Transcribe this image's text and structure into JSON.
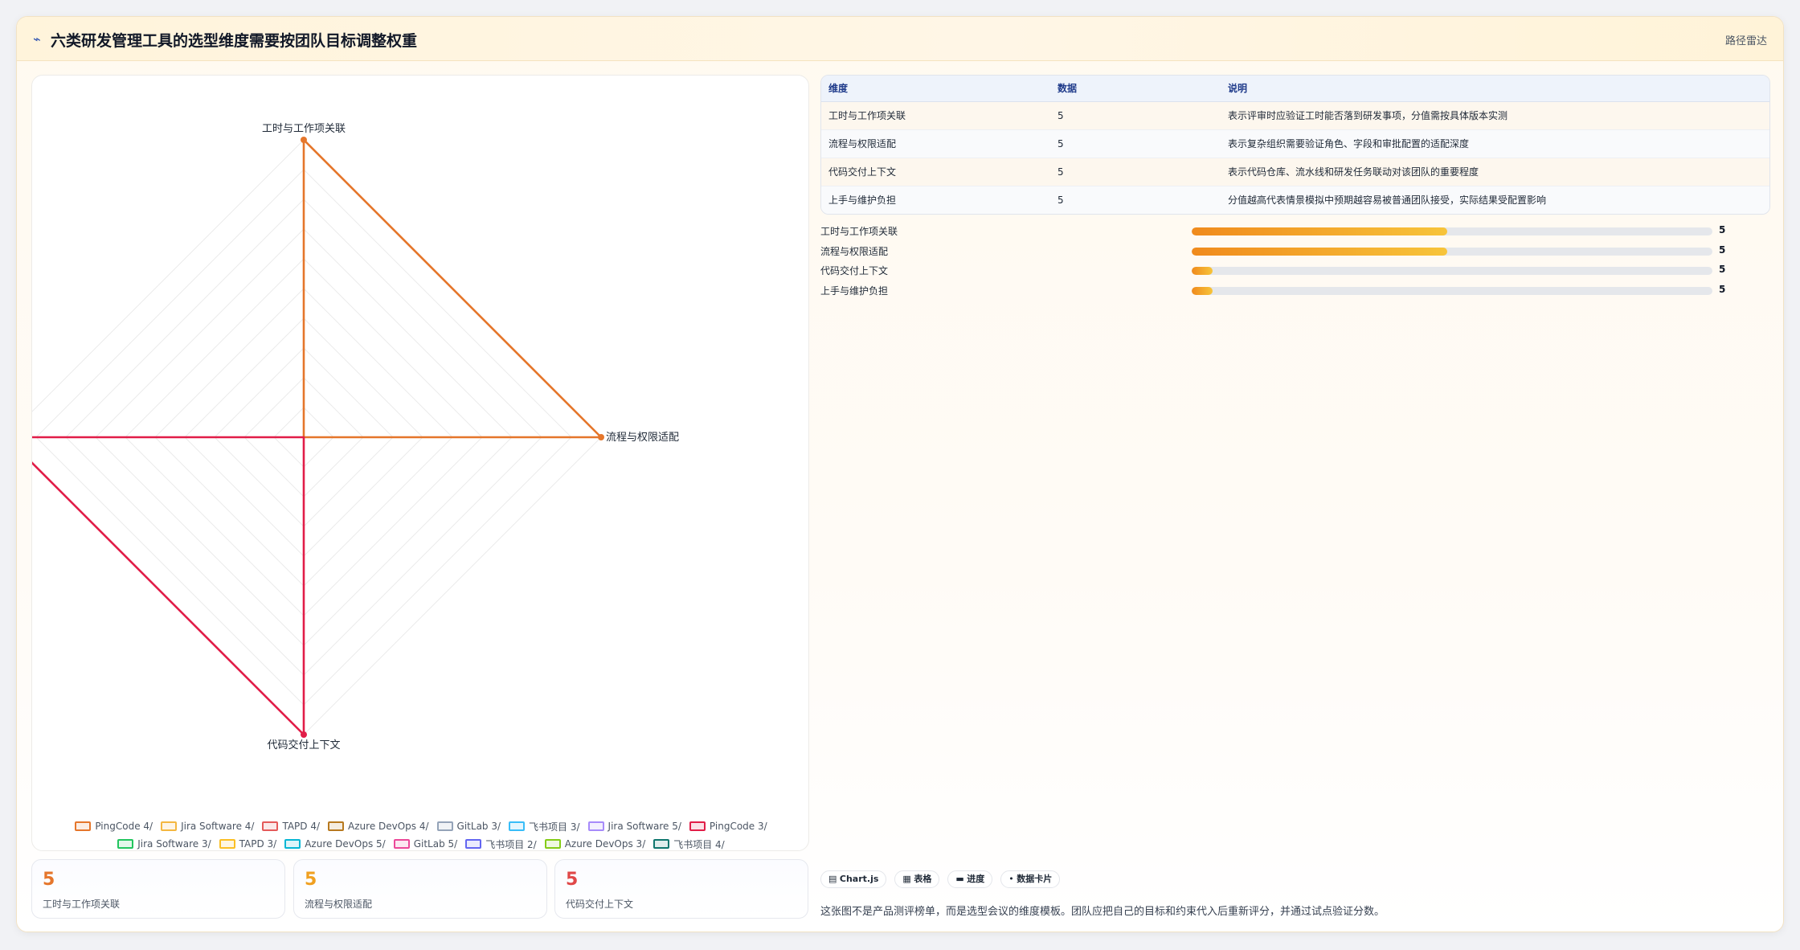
{
  "header": {
    "icon": "trend-line-icon",
    "title": "六类研发管理工具的选型维度需要按团队目标调整权重",
    "link": "路径雷达"
  },
  "chart_data": {
    "type": "radar",
    "axes": [
      "工时与工作项关联",
      "流程与权限适配",
      "代码交付上下文",
      "上手与维护负担"
    ],
    "rmax": 5,
    "grid_rings": 10,
    "series": [
      {
        "name": "PingCode 4/",
        "color": "#e5762b",
        "values": [
          5,
          5,
          0,
          0
        ]
      },
      {
        "name": "Jira Software 4/",
        "color": "#f4b740",
        "values": [
          0,
          0,
          0,
          0
        ]
      },
      {
        "name": "TAPD 4/",
        "color": "#e45a5a",
        "values": [
          0,
          0,
          0,
          0
        ]
      },
      {
        "name": "Azure DevOps 4/",
        "color": "#b7791f",
        "values": [
          0,
          0,
          0,
          0
        ]
      },
      {
        "name": "GitLab 3/",
        "color": "#94a3b8",
        "values": [
          0,
          0,
          0,
          0
        ]
      },
      {
        "name": "飞书项目 3/",
        "color": "#38bdf8",
        "values": [
          0,
          0,
          0,
          0
        ]
      },
      {
        "name": "Jira Software 5/",
        "color": "#a78bfa",
        "values": [
          0,
          0,
          0,
          0
        ]
      },
      {
        "name": "PingCode 3/",
        "color": "#e11d48",
        "values": [
          0,
          0,
          5,
          5
        ]
      },
      {
        "name": "Jira Software 3/",
        "color": "#22c55e",
        "values": [
          0,
          0,
          0,
          0
        ]
      },
      {
        "name": "TAPD 3/",
        "color": "#fbbf24",
        "values": [
          0,
          0,
          0,
          0
        ]
      },
      {
        "name": "Azure DevOps 5/",
        "color": "#06b6d4",
        "values": [
          0,
          0,
          0,
          0
        ]
      },
      {
        "name": "GitLab 5/",
        "color": "#ec4899",
        "values": [
          0,
          0,
          0,
          0
        ]
      },
      {
        "name": "飞书项目 2/",
        "color": "#6366f1",
        "values": [
          0,
          0,
          0,
          0
        ]
      },
      {
        "name": "Azure DevOps 3/",
        "color": "#84cc16",
        "values": [
          0,
          0,
          0,
          0
        ]
      },
      {
        "name": "飞书项目 4/",
        "color": "#0f766e",
        "values": [
          0,
          0,
          0,
          0
        ]
      }
    ],
    "legend_placement": "bottom"
  },
  "kpis": [
    {
      "value": "5",
      "label": "工时与工作项关联",
      "color": "#e5762b"
    },
    {
      "value": "5",
      "label": "流程与权限适配",
      "color": "#f0a020"
    },
    {
      "value": "5",
      "label": "代码交付上下文",
      "color": "#e04848"
    }
  ],
  "table": {
    "headers": [
      "维度",
      "数据",
      "说明"
    ],
    "rows": [
      [
        "工时与工作项关联",
        "5",
        "表示评审时应验证工时能否落到研发事项，分值需按具体版本实测"
      ],
      [
        "流程与权限适配",
        "5",
        "表示复杂组织需要验证角色、字段和审批配置的适配深度"
      ],
      [
        "代码交付上下文",
        "5",
        "表示代码仓库、流水线和研发任务联动对该团队的重要程度"
      ],
      [
        "上手与维护负担",
        "5",
        "分值越高代表情景模拟中预期越容易被普通团队接受，实际结果受配置影响"
      ]
    ]
  },
  "bars": [
    {
      "label": "工时与工作项关联",
      "value": "5",
      "fill": 0.49
    },
    {
      "label": "流程与权限适配",
      "value": "5",
      "fill": 0.49
    },
    {
      "label": "代码交付上下文",
      "value": "5",
      "fill": 0.04
    },
    {
      "label": "上手与维护负担",
      "value": "5",
      "fill": 0.04
    }
  ],
  "tags": [
    {
      "icon": "chart-icon",
      "glyph": "▤",
      "label": "Chart.js"
    },
    {
      "icon": "table-icon",
      "glyph": "▦",
      "label": "表格"
    },
    {
      "icon": "progress-icon",
      "glyph": "▬",
      "label": "进度"
    },
    {
      "icon": "card-icon",
      "glyph": "•",
      "label": "数据卡片"
    }
  ],
  "footnote": "这张图不是产品测评榜单，而是选型会议的维度模板。团队应把自己的目标和约束代入后重新评分，并通过试点验证分数。"
}
